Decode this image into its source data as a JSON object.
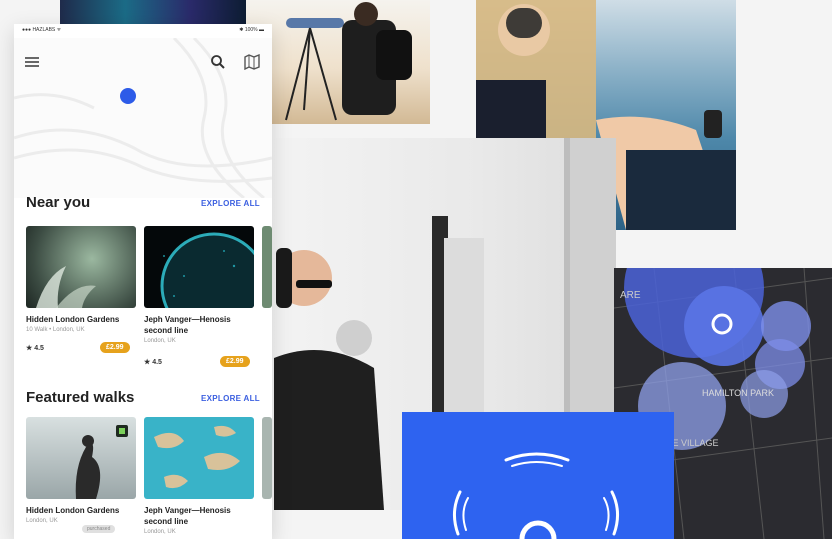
{
  "status_bar": {
    "carrier": "●●● HAZLABS ᯤ",
    "time": "",
    "battery": "✱ 100% ▬"
  },
  "header": {
    "menu_icon": "hamburger-icon",
    "search_icon": "search-icon",
    "map_icon": "map-icon"
  },
  "near_you": {
    "title": "Near you",
    "explore_label": "EXPLORE ALL",
    "cards": [
      {
        "title": "Hidden London Gardens",
        "subtitle": "10 Walk • London, UK",
        "rating": "★ 4.5",
        "price": "£2.99"
      },
      {
        "title": "Jeph Vanger—Henosis second line",
        "subtitle": "London, UK",
        "rating": "★ 4.5",
        "price": "£2.99"
      }
    ]
  },
  "featured_walks": {
    "title": "Featured walks",
    "explore_label": "EXPLORE ALL",
    "cards": [
      {
        "title": "Hidden London Gardens",
        "subtitle": "London, UK",
        "badge": "purchased"
      },
      {
        "title": "Jeph Vanger—Henosis second line",
        "subtitle": "London, UK"
      }
    ]
  },
  "map_labels": {
    "area_label": "ARE",
    "district_label": "HAMILTON PARK",
    "village_label": "NE VILLAGE"
  },
  "colors": {
    "accent": "#3b5fe0",
    "price_badge": "#e6a21c",
    "blue_card": "#2e63f0",
    "map_bg": "#2b2b30",
    "map_bubble": "#4b63d8"
  }
}
